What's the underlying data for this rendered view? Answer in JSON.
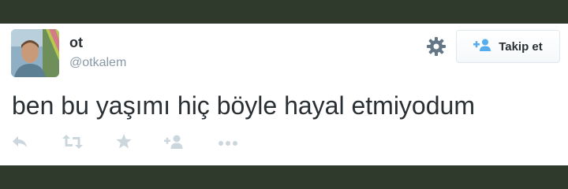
{
  "tweet": {
    "author": {
      "display_name": "ot",
      "handle": "@otkalem",
      "avatar_icon": "profile-photo"
    },
    "text": "ben bu yaşımı hiç böyle hayal etmiyodum",
    "follow_button": {
      "label": "Takip et",
      "icon": "add-user-icon"
    },
    "settings_icon": "gear-icon",
    "actions": [
      {
        "name": "reply",
        "icon": "reply-icon"
      },
      {
        "name": "retweet",
        "icon": "retweet-icon"
      },
      {
        "name": "favorite",
        "icon": "star-icon"
      },
      {
        "name": "follow",
        "icon": "add-user-icon"
      },
      {
        "name": "more",
        "icon": "more-icon"
      }
    ]
  },
  "colors": {
    "background": "#2f3a2c",
    "card": "#ffffff",
    "text": "#292f33",
    "muted": "#8899a6",
    "action_icon": "#ccd6dd",
    "follow_icon": "#55acee"
  }
}
